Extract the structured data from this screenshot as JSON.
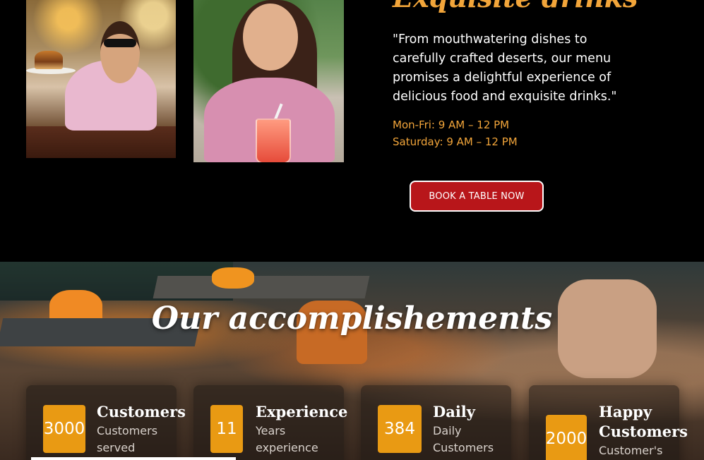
{
  "hero": {
    "heading": "Exquisite drinks",
    "quote": "\"From mouthwatering dishes to carefully crafted deserts, our menu promises a delightful experience of delicious food and exquisite drinks.\"",
    "hours": [
      "Mon-Fri: 9 AM – 12 PM",
      "Saturday: 9 AM – 12 PM"
    ],
    "cta_label": "BOOK A TABLE NOW"
  },
  "accomplishments": {
    "title": "Our accomplishements",
    "cards": [
      {
        "value": "3000",
        "title": "Customers",
        "subtitle": "Customers served"
      },
      {
        "value": "11",
        "title": "Experience",
        "subtitle": "Years experience"
      },
      {
        "value": "384",
        "title": "Daily",
        "subtitle": "Daily Customers"
      },
      {
        "value": "2000",
        "title": "Happy Customers",
        "subtitle": "Customer's"
      }
    ]
  },
  "colors": {
    "accent": "#f2a53a",
    "button": "#b8161a",
    "badge": "#e99a13"
  }
}
